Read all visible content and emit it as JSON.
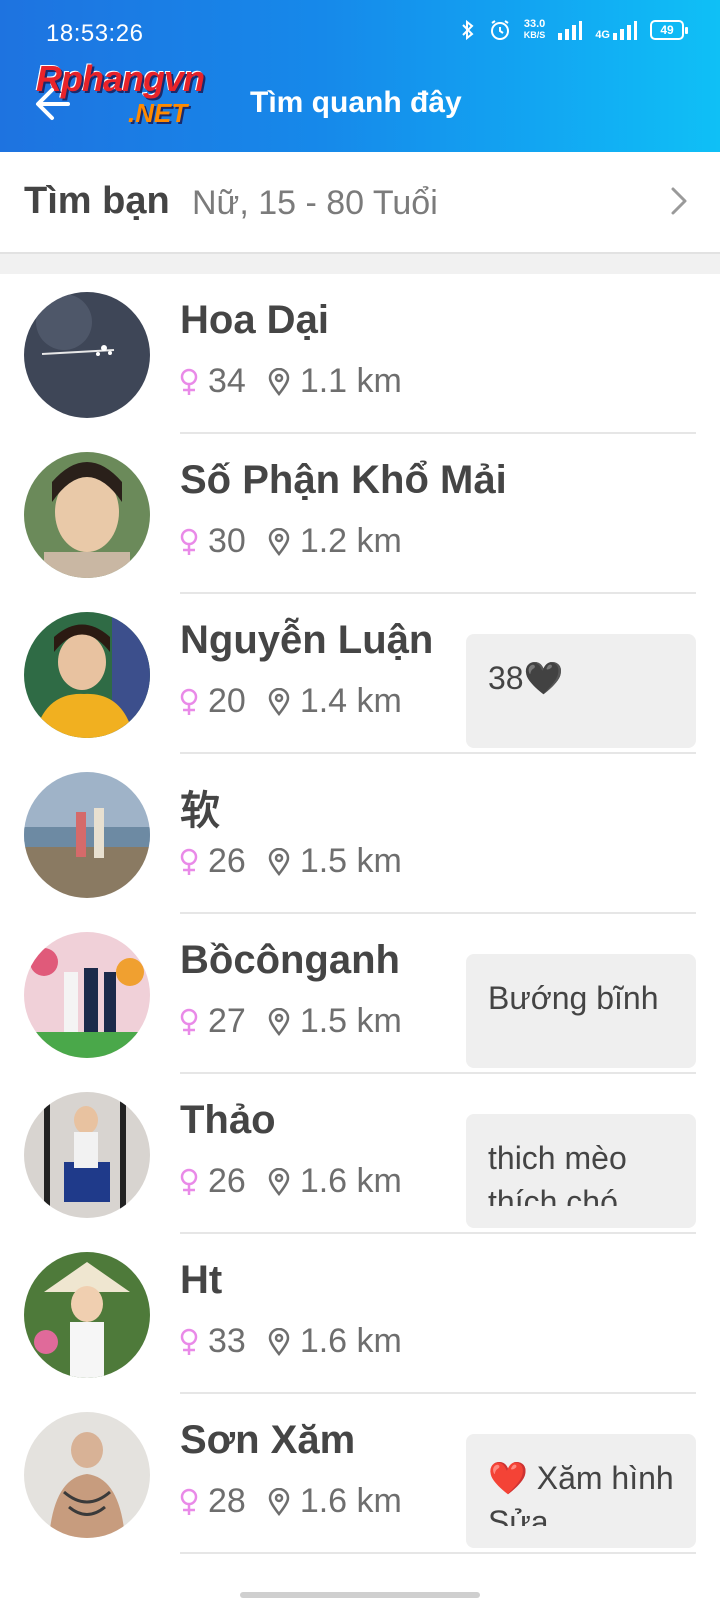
{
  "status_bar": {
    "time": "18:53:26",
    "net_speed": "33.0",
    "net_unit": "KB/S",
    "network": "4G",
    "battery": "49"
  },
  "header": {
    "logo_text": "Rphangvn",
    "logo_suffix": ".NET",
    "title": "Tìm quanh đây"
  },
  "filter": {
    "title": "Tìm bạn",
    "value": "Nữ, 15 - 80 Tuổi"
  },
  "users": [
    {
      "name": "Hoa Dại",
      "age": "34",
      "distance": "1.1 km",
      "status": ""
    },
    {
      "name": "Số Phận Khổ Mải",
      "age": "30",
      "distance": "1.2 km",
      "status": ""
    },
    {
      "name": "Nguyễn Luận",
      "age": "20",
      "distance": "1.4 km",
      "status": "38🖤"
    },
    {
      "name": "软",
      "age": "26",
      "distance": "1.5 km",
      "status": ""
    },
    {
      "name": "Bồcônganh",
      "age": "27",
      "distance": "1.5 km",
      "status": "Bướng bĩnh"
    },
    {
      "name": "Thảo",
      "age": "26",
      "distance": "1.6 km",
      "status": "thich mèo thích chó"
    },
    {
      "name": "Ht",
      "age": "33",
      "distance": "1.6 km",
      "status": ""
    },
    {
      "name": "Sơn Xăm",
      "age": "28",
      "distance": "1.6 km",
      "status": "❤️ Xăm hình Sửa"
    }
  ],
  "colors": {
    "header_gradient_start": "#1e73e0",
    "header_gradient_end": "#0fc0f6",
    "gender_female": "#e98ae8",
    "text_primary": "#454545"
  },
  "icons": {
    "back": "arrow-left-icon",
    "chevron": "chevron-right-icon",
    "gender": "female-icon",
    "location": "map-pin-icon"
  }
}
